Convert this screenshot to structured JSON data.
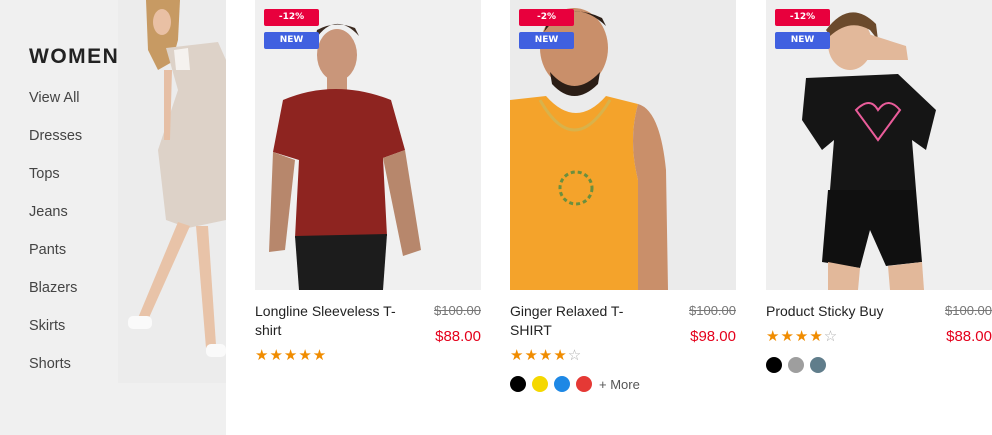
{
  "sidebar": {
    "title": "WOMEN",
    "items": [
      {
        "label": "View All"
      },
      {
        "label": "Dresses"
      },
      {
        "label": "Tops"
      },
      {
        "label": "Jeans"
      },
      {
        "label": "Pants"
      },
      {
        "label": "Blazers"
      },
      {
        "label": "Skirts"
      },
      {
        "label": "Shorts"
      }
    ]
  },
  "badge_colors": {
    "sale": "#e8003d",
    "new": "#4060e0"
  },
  "products": [
    {
      "name": "Longline Sleeveless T-shirt",
      "discount": "-12%",
      "badge": "NEW",
      "old_price": "$100.00",
      "price": "$88.00",
      "rating": 5,
      "stars": "★★★★★",
      "stars_empty": "",
      "swatches": [],
      "more": ""
    },
    {
      "name": "Ginger Relaxed T-SHIRT",
      "discount": "-2%",
      "badge": "NEW",
      "old_price": "$100.00",
      "price": "$98.00",
      "rating": 4,
      "stars": "★★★★",
      "stars_empty": "☆",
      "swatches": [
        "#000000",
        "#f5d800",
        "#1e88e5",
        "#e53935"
      ],
      "more": "+ More"
    },
    {
      "name": "Product Sticky Buy",
      "discount": "-12%",
      "badge": "NEW",
      "old_price": "$100.00",
      "price": "$88.00",
      "rating": 4,
      "stars": "★★★★",
      "stars_empty": "☆",
      "swatches": [
        "#000000",
        "#9e9e9e",
        "#607d8b"
      ],
      "more": ""
    }
  ]
}
